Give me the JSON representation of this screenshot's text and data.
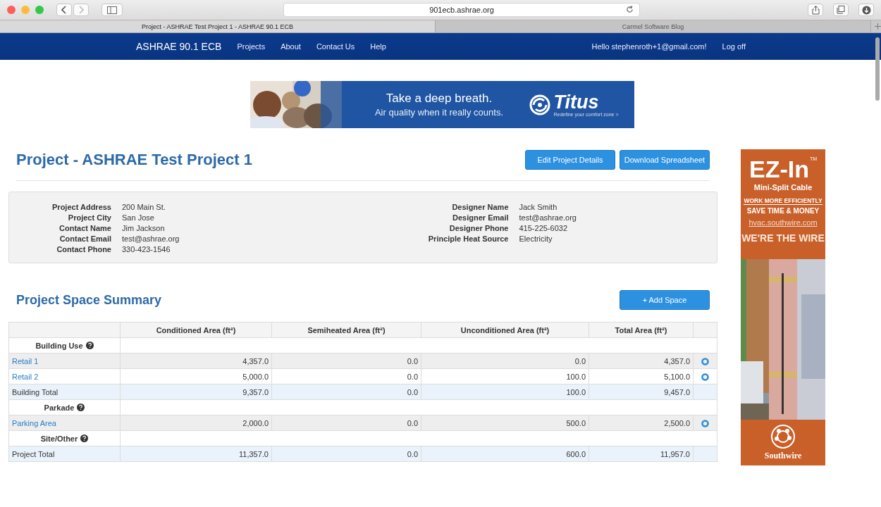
{
  "browser": {
    "url": "901ecb.ashrae.org",
    "tabs": [
      {
        "title": "Project - ASHRAE Test Project 1 - ASHRAE 90.1 ECB",
        "selected": true
      },
      {
        "title": "Carmel Software Blog",
        "selected": false
      }
    ]
  },
  "navbar": {
    "brand": "ASHRAE 90.1 ECB",
    "links": [
      "Projects",
      "About",
      "Contact Us",
      "Help"
    ],
    "greeting": "Hello stephenroth+1@gmail.com!",
    "logout": "Log off"
  },
  "banner_ad": {
    "headline": "Take a deep breath.",
    "tagline": "Air quality when it really counts.",
    "brand": "Titus",
    "slogan": "Redefine your comfort zone >"
  },
  "project": {
    "title": "Project - ASHRAE Test Project 1",
    "buttons": [
      "Edit Project Details",
      "Download Spreadsheet"
    ],
    "details_left": [
      {
        "label": "Project Address",
        "value": "200 Main St."
      },
      {
        "label": "Project City",
        "value": "San Jose"
      },
      {
        "label": "Contact Name",
        "value": "Jim Jackson"
      },
      {
        "label": "Contact Email",
        "value": "test@ashrae.org"
      },
      {
        "label": "Contact Phone",
        "value": "330-423-1546"
      }
    ],
    "details_right": [
      {
        "label": "Designer Name",
        "value": "Jack Smith"
      },
      {
        "label": "Designer Email",
        "value": "test@ashrae.org"
      },
      {
        "label": "Designer Phone",
        "value": "415-225-6032"
      },
      {
        "label": "Principle Heat Source",
        "value": "Electricity"
      }
    ]
  },
  "space_summary": {
    "title": "Project Space Summary",
    "add_button": "+ Add Space",
    "columns": [
      "Conditioned Area (ft²)",
      "Semiheated Area (ft²)",
      "Unconditioned Area (ft²)",
      "Total Area (ft²)"
    ],
    "rows": [
      {
        "kind": "group",
        "name": "Building Use"
      },
      {
        "kind": "item",
        "name": "Retail 1",
        "values": [
          "4,357.0",
          "0.0",
          "0.0",
          "4,357.0"
        ],
        "shaded": true
      },
      {
        "kind": "item",
        "name": "Retail 2",
        "values": [
          "5,000.0",
          "0.0",
          "100.0",
          "5,100.0"
        ],
        "shaded": false
      },
      {
        "kind": "total",
        "name": "Building Total",
        "values": [
          "9,357.0",
          "0.0",
          "100.0",
          "9,457.0"
        ]
      },
      {
        "kind": "group",
        "name": "Parkade"
      },
      {
        "kind": "item",
        "name": "Parking Area",
        "values": [
          "2,000.0",
          "0.0",
          "500.0",
          "2,500.0"
        ],
        "shaded": true
      },
      {
        "kind": "group",
        "name": "Site/Other"
      },
      {
        "kind": "total",
        "name": "Project Total",
        "values": [
          "11,357.0",
          "0.0",
          "600.0",
          "11,957.0"
        ]
      }
    ]
  },
  "side_ad": {
    "title": "EZ-In",
    "trademark": "TM",
    "subtitle": "Mini-Split Cable",
    "line1": "WORK MORE EFFICIENTLY",
    "line2": "SAVE TIME & MONEY",
    "url": "hvac.southwire.com",
    "slogan": "WE'RE THE WIRE",
    "brand": "Southwire"
  }
}
